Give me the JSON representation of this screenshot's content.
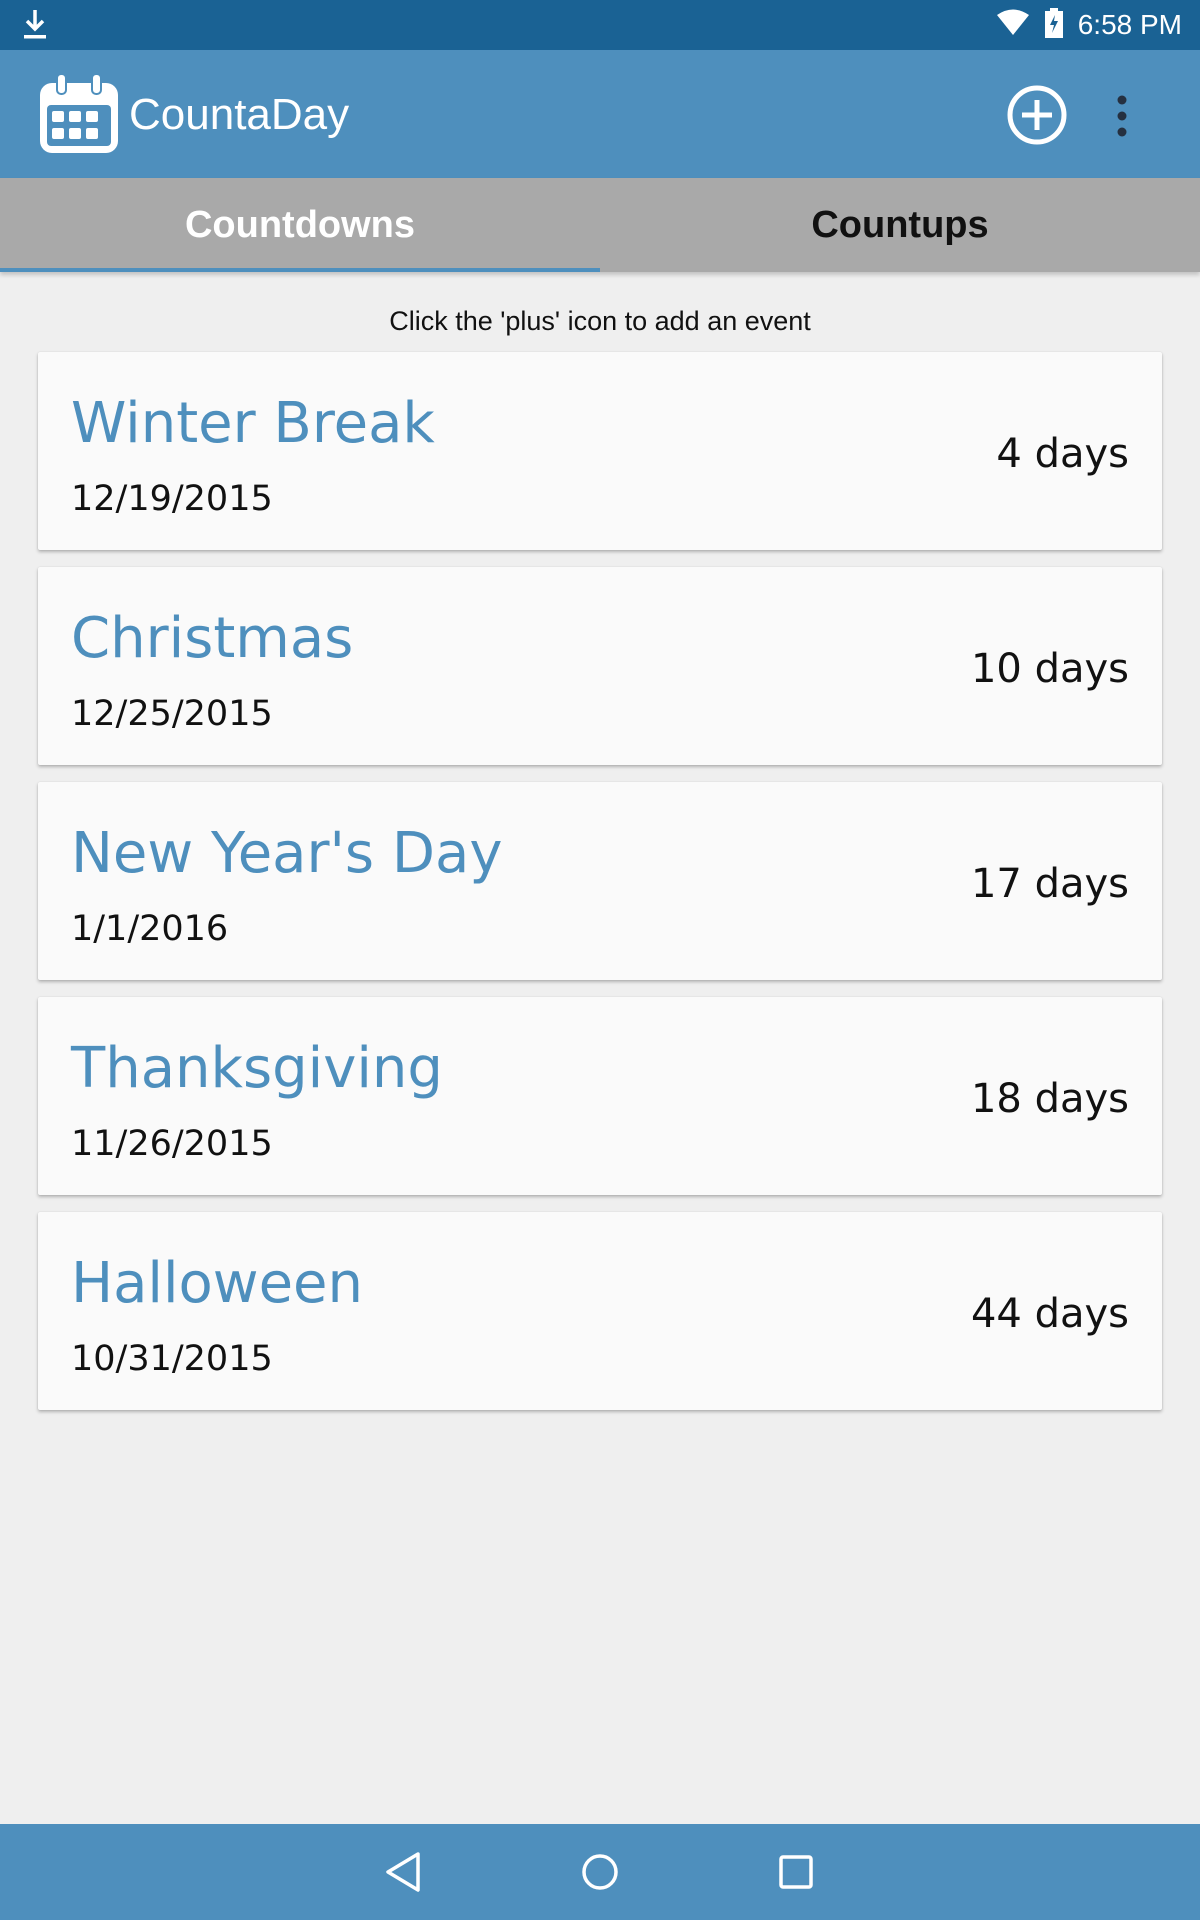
{
  "status_bar": {
    "time": "6:58 PM",
    "icons": [
      "download-icon",
      "wifi-icon",
      "battery-charging-icon"
    ]
  },
  "app_bar": {
    "title": "CountaDay",
    "icons": [
      "calendar-logo-icon",
      "add-circle-icon",
      "overflow-menu-icon"
    ]
  },
  "tabs": [
    {
      "label": "Countdowns",
      "active": true
    },
    {
      "label": "Countups",
      "active": false
    }
  ],
  "hint": "Click the 'plus' icon to add an event",
  "events": [
    {
      "name": "Winter Break",
      "date": "12/19/2015",
      "days": "4 days"
    },
    {
      "name": "Christmas",
      "date": "12/25/2015",
      "days": "10 days"
    },
    {
      "name": "New Year's Day",
      "date": "1/1/2016",
      "days": "17 days"
    },
    {
      "name": "Thanksgiving",
      "date": "11/26/2015",
      "days": "18 days"
    },
    {
      "name": "Halloween",
      "date": "10/31/2015",
      "days": "44 days"
    }
  ],
  "nav_bar": {
    "icons": [
      "back-icon",
      "home-icon",
      "recents-icon"
    ]
  },
  "colors": {
    "status_bar": "#1a6294",
    "app_bar": "#4e8fbd",
    "tab_bar": "#a9a9a9",
    "event_title": "#4e8fbd",
    "background": "#efefef"
  }
}
